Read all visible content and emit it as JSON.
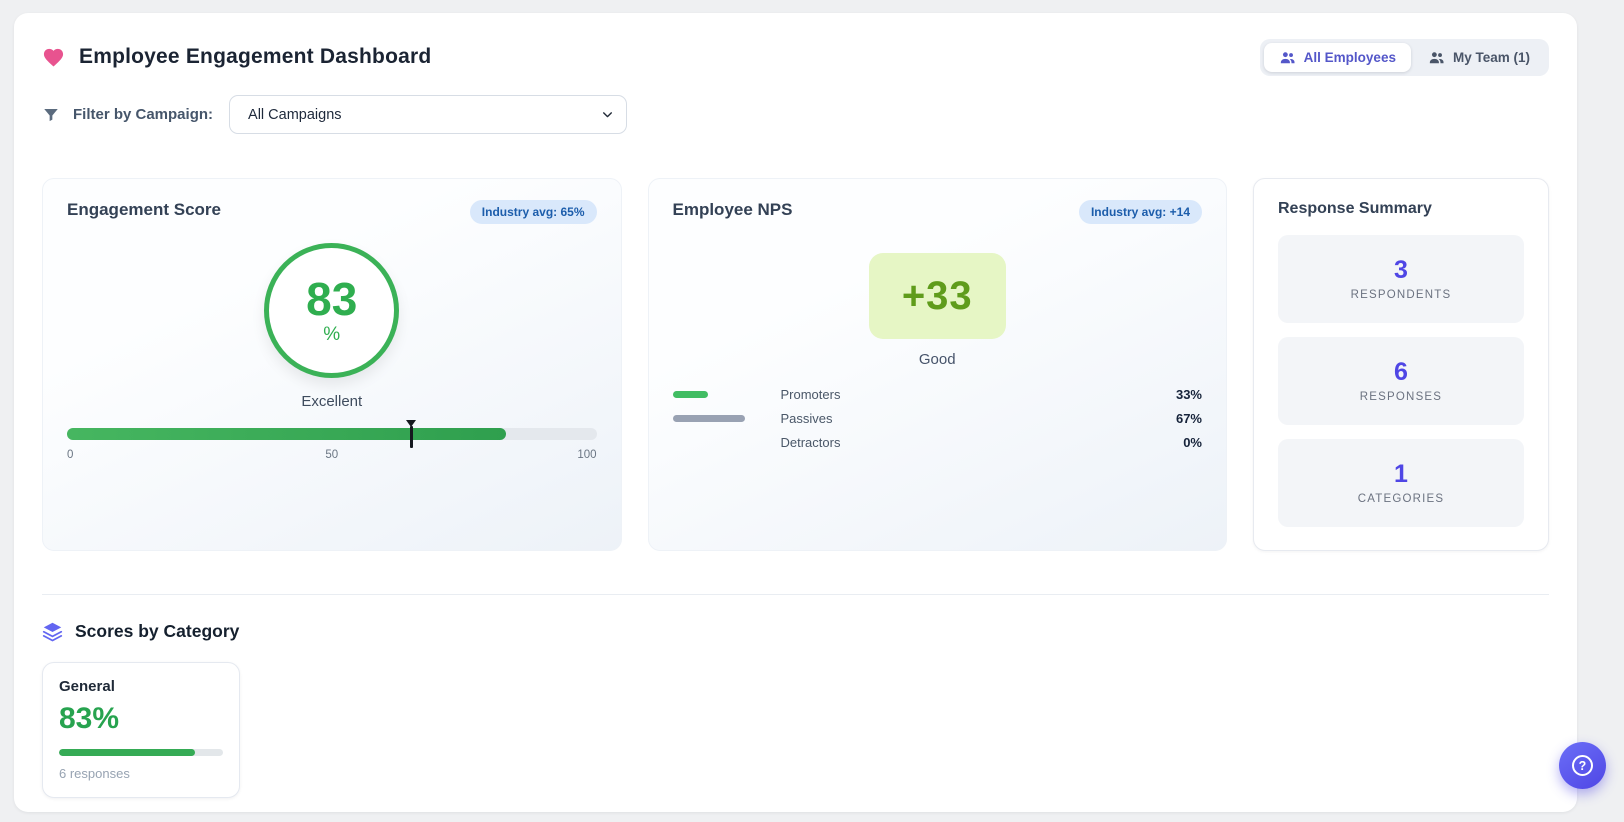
{
  "colors": {
    "heart": "#e8538f",
    "accent_purple": "#5457c9",
    "indigo_icon": "#6366f1",
    "badge_bg": "#d9e8fb",
    "badge_text": "#1c5dab",
    "green": "#2fae4f",
    "nps_box_bg": "#e6f6c5",
    "nps_text": "#5f9c1b",
    "stat_number": "#4f46e5",
    "promoters_bar": "#41bd63",
    "passives_bar": "#99a2b3"
  },
  "header": {
    "title": "Employee Engagement Dashboard",
    "toggle": {
      "all_employees": "All Employees",
      "my_team": "My Team (1)"
    }
  },
  "filter": {
    "label": "Filter by Campaign:",
    "selected": "All Campaigns"
  },
  "engagement_card": {
    "title": "Engagement Score",
    "badge": "Industry avg: 65%",
    "score": "83",
    "unit": "%",
    "rating": "Excellent",
    "bar_percent": 83,
    "marker_percent": 65,
    "scale": {
      "min": "0",
      "mid": "50",
      "max": "100"
    }
  },
  "nps_card": {
    "title": "Employee NPS",
    "badge": "Industry avg: +14",
    "score": "+33",
    "rating": "Good",
    "legend": [
      {
        "label": "Promoters",
        "value": "33%",
        "pct": 33
      },
      {
        "label": "Passives",
        "value": "67%",
        "pct": 67
      },
      {
        "label": "Detractors",
        "value": "0%",
        "pct": 0
      }
    ]
  },
  "summary_card": {
    "title": "Response Summary",
    "stats": [
      {
        "value": "3",
        "label": "RESPONDENTS"
      },
      {
        "value": "6",
        "label": "RESPONSES"
      },
      {
        "value": "1",
        "label": "CATEGORIES"
      }
    ]
  },
  "categories_section": {
    "title": "Scores by Category",
    "cards": [
      {
        "name": "General",
        "score": "83%",
        "pct": 83,
        "responses": "6 responses"
      }
    ]
  },
  "help_button": {
    "label": "?"
  }
}
